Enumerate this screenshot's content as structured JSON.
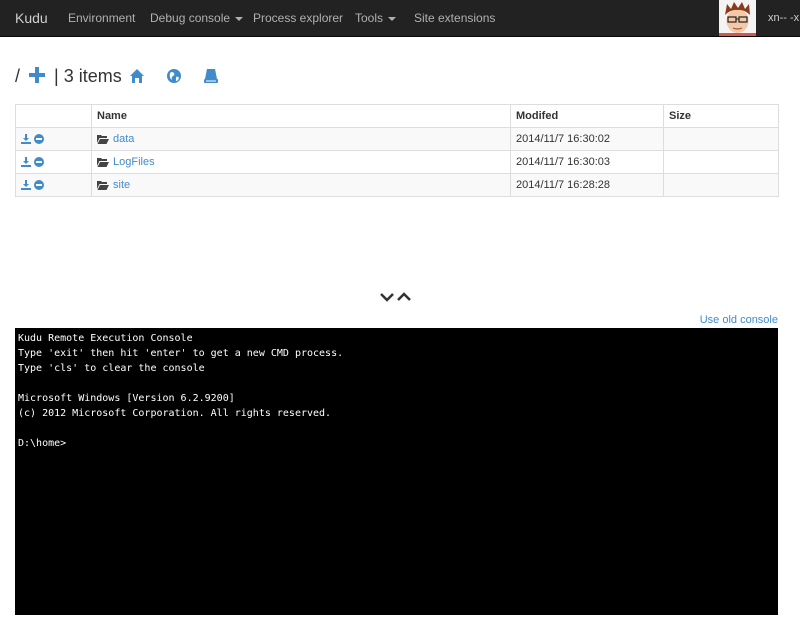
{
  "nav": {
    "brand": "Kudu",
    "items": [
      {
        "label": "Environment",
        "dropdown": false
      },
      {
        "label": "Debug console",
        "dropdown": true
      },
      {
        "label": "Process explorer",
        "dropdown": false
      },
      {
        "label": "Tools",
        "dropdown": true
      },
      {
        "label": "Site extensions",
        "dropdown": false
      }
    ],
    "user": "xn-- -x"
  },
  "path": {
    "root": "/",
    "separator": "|",
    "count": "3 items"
  },
  "table": {
    "headers": [
      "Name",
      "Modifed",
      "Size"
    ],
    "rows": [
      {
        "name": "data",
        "modified": "2014/11/7 16:30:02",
        "size": ""
      },
      {
        "name": "LogFiles",
        "modified": "2014/11/7 16:30:03",
        "size": ""
      },
      {
        "name": "site",
        "modified": "2014/11/7 16:28:28",
        "size": ""
      }
    ]
  },
  "old_console_link": "Use old console",
  "console": {
    "lines": [
      "Kudu Remote Execution Console",
      "Type 'exit' then hit 'enter' to get a new CMD process.",
      "Type 'cls' to clear the console",
      "",
      "Microsoft Windows [Version 6.2.9200]",
      "(c) 2012 Microsoft Corporation. All rights reserved.",
      "",
      "D:\\home>"
    ]
  },
  "colors": {
    "navbar": "#222222",
    "accent": "#428bca",
    "console_bg": "#000000"
  },
  "icons": [
    "plus-icon",
    "home-icon",
    "globe-icon",
    "drive-icon",
    "download-icon",
    "minus-circle-icon",
    "folder-open-icon",
    "chevron-down-icon",
    "chevron-up-icon"
  ]
}
